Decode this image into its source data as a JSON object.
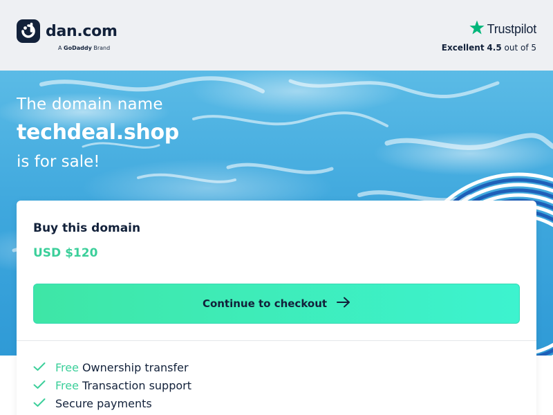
{
  "header": {
    "logo_name": "dan.com",
    "brand_prefix": "A",
    "brand_name": "GoDaddy",
    "brand_suffix": "Brand",
    "trustpilot": {
      "name": "Trustpilot",
      "rating_label": "Excellent",
      "rating_value": "4.5",
      "rating_suffix": "out of 5",
      "icon": "star-icon"
    }
  },
  "hero": {
    "line1": "The domain name",
    "domain": "techdeal.shop",
    "line3": "is for sale!"
  },
  "card": {
    "title": "Buy this domain",
    "price": "USD $120",
    "checkout_label": "Continue to checkout",
    "checkout_icon": "arrow-right-icon",
    "features": [
      {
        "free": "Free",
        "text": "Ownership transfer"
      },
      {
        "free": "Free",
        "text": "Transaction support"
      },
      {
        "free": "",
        "text": "Secure payments"
      }
    ]
  },
  "colors": {
    "brand_dark": "#12213a",
    "accent_green": "#3bcf9a",
    "trustpilot_green": "#00b67a",
    "header_bg": "#eef0f3"
  }
}
